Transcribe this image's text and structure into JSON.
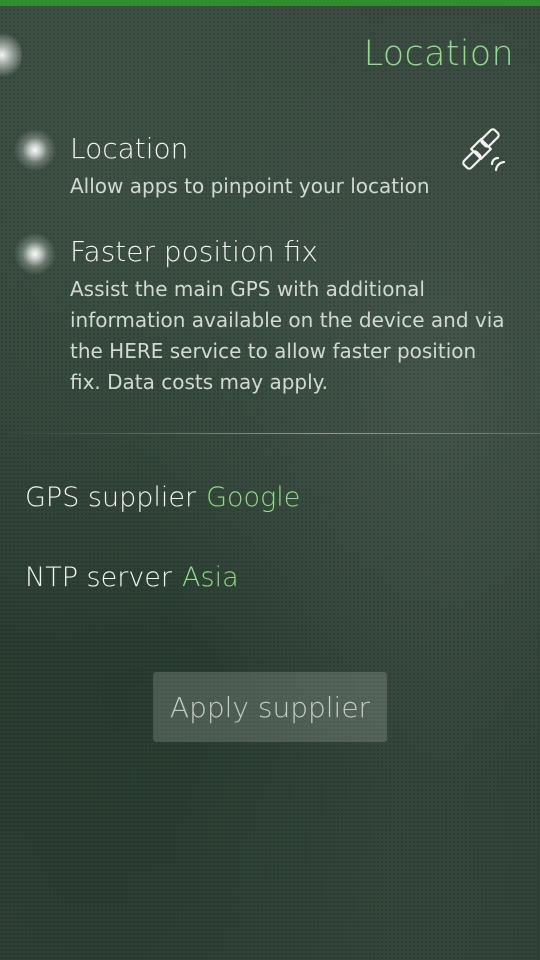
{
  "header": {
    "title": "Location"
  },
  "location_switch": {
    "title": "Location",
    "description": "Allow apps to pinpoint your location",
    "icon": "satellite-icon"
  },
  "faster_fix_switch": {
    "title": "Faster position fix",
    "description": "Assist the main GPS with additional information available on the device and via the HERE service to allow faster position fix. Data costs may apply."
  },
  "gps_supplier": {
    "label": "GPS supplier",
    "value": "Google"
  },
  "ntp_server": {
    "label": "NTP server",
    "value": "Asia"
  },
  "apply_button": {
    "label": "Apply supplier"
  },
  "colors": {
    "accent": "#8fdc8a",
    "top_bar": "#2f8f2f"
  }
}
